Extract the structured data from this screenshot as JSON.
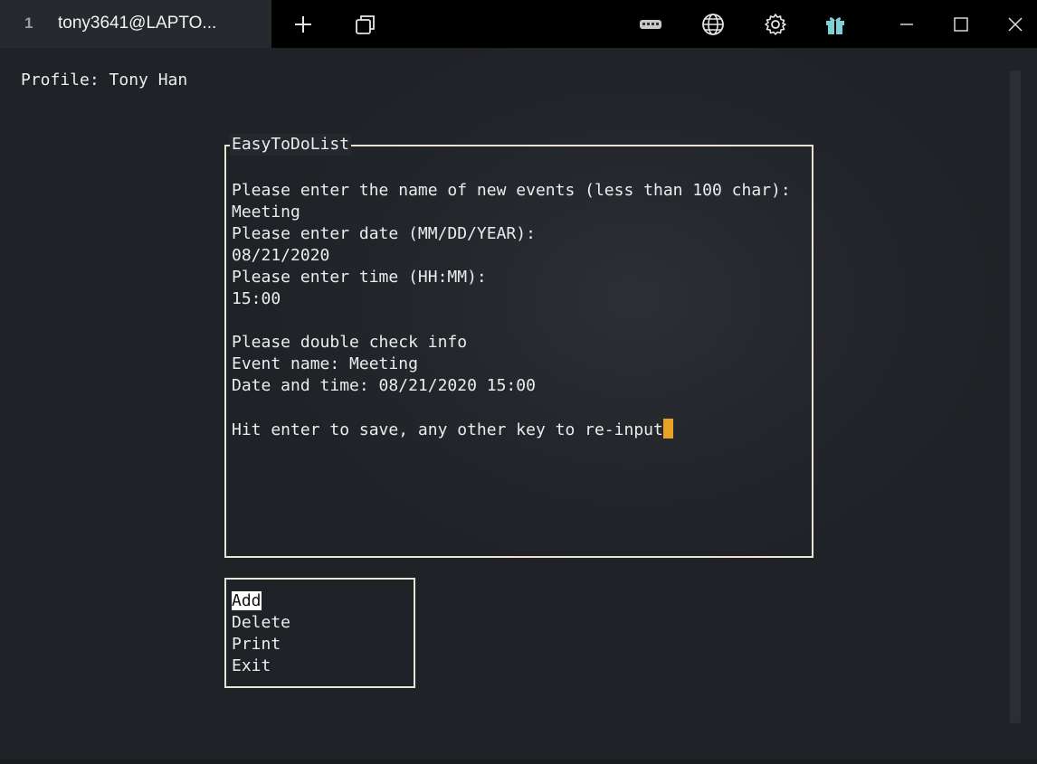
{
  "tab": {
    "index": "1",
    "title": "tony3641@LAPTO..."
  },
  "toolbar": {
    "new_tab_icon": "plus-icon",
    "duplicate_icon": "duplicate-tab-icon",
    "keyboard_icon": "keyboard-icon",
    "globe_icon": "globe-icon",
    "settings_icon": "gear-icon",
    "gift_icon": "gift-icon"
  },
  "window_controls": {
    "minimize": "minimize-icon",
    "maximize": "maximize-icon",
    "close": "close-icon"
  },
  "terminal": {
    "profile": "Profile: Tony Han",
    "main_window": {
      "title": "EasyToDoList",
      "lines": [
        "Please enter the name of new events (less than 100 char):",
        "Meeting",
        "Please enter date (MM/DD/YEAR):",
        "08/21/2020",
        "Please enter time (HH:MM):",
        "15:00",
        "Please double check info",
        "Event name: Meeting",
        "Date and time: 08/21/2020 15:00",
        "Hit enter to save, any other key to re-input"
      ]
    },
    "menu": {
      "items": [
        "Add",
        "Delete",
        "Print",
        "Exit"
      ],
      "selected": "Add"
    }
  },
  "colors": {
    "cursor": "#e6a126",
    "gift_icon": "#7fd0d4",
    "frame": "#e8e2cf"
  }
}
